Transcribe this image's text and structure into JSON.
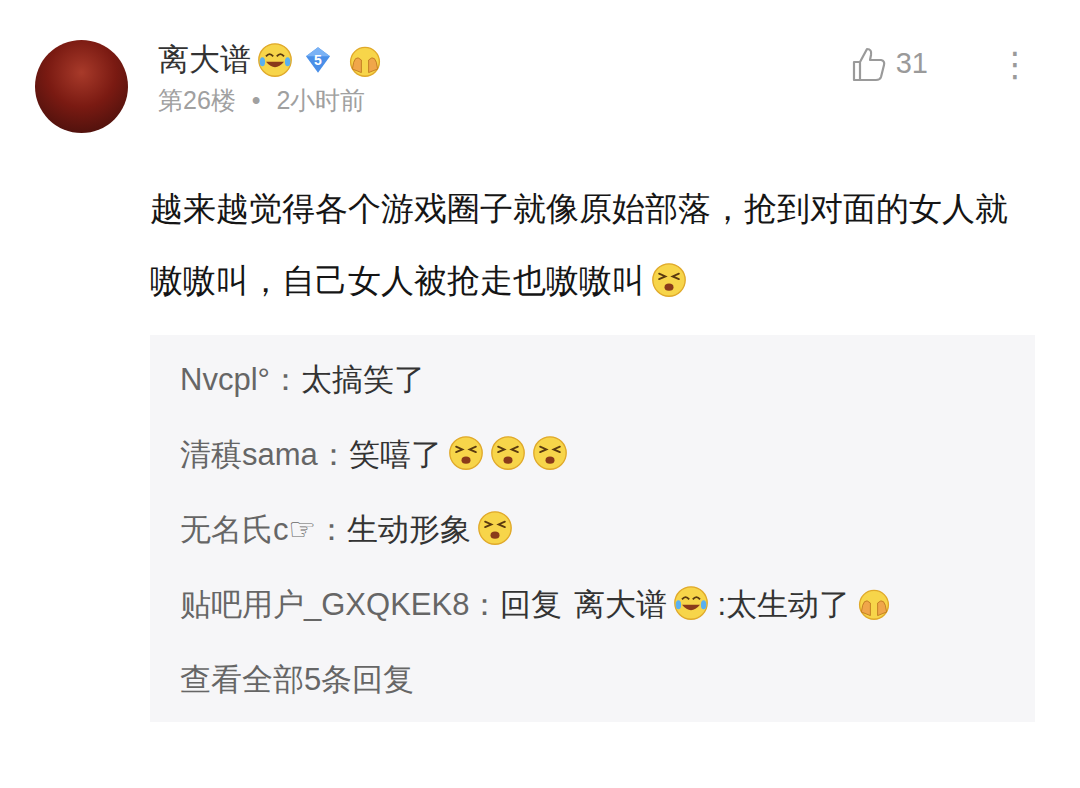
{
  "post": {
    "author": "离大谱",
    "level": "5",
    "floor": "第26楼",
    "separator": "•",
    "time": "2小时前",
    "likes": "31",
    "more": "⋮",
    "content": "越来越觉得各个游戏圈子就像原始部落，抢到对面的女人就嗷嗷叫，自己女人被抢走也嗷嗷叫",
    "emoticon_count": 1
  },
  "replies": [
    {
      "author": "Nvcpl°",
      "colon": "：",
      "text": "太搞笑了",
      "emoticon_count": 0
    },
    {
      "author": "清稹sama",
      "colon": "：",
      "text": "笑嘻了",
      "emoticon_count": 3
    },
    {
      "author": "无名氏c☞",
      "colon": "：",
      "text": "生动形象",
      "emoticon_count": 1
    },
    {
      "author": "贴吧用户_GXQKEK8",
      "colon": "：",
      "reply_prefix": "回复",
      "reply_target": "离大谱",
      "text": ":太生动了",
      "emoticon_count": 1
    }
  ],
  "view_all": "查看全部5条回复"
}
